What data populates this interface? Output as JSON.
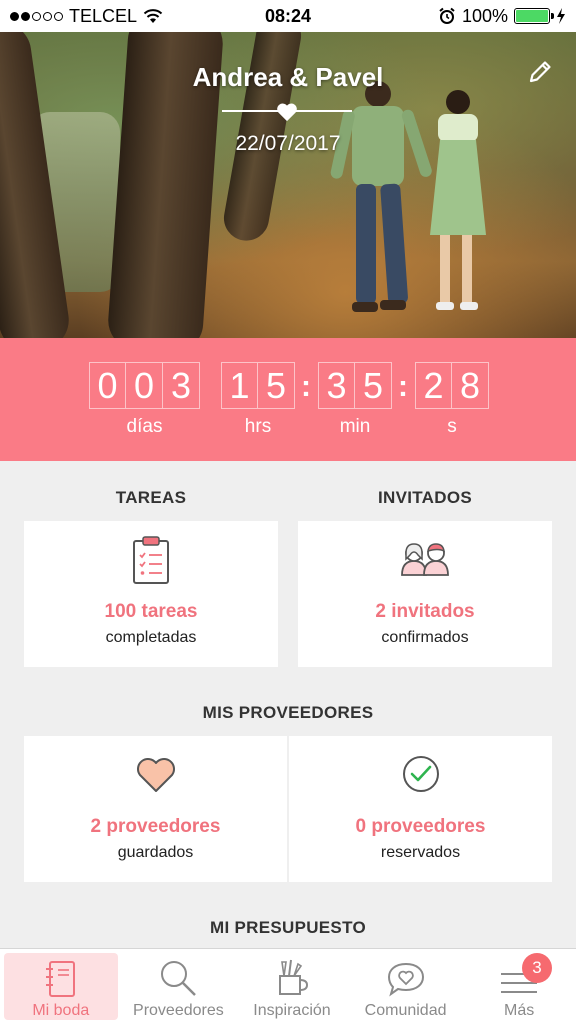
{
  "status_bar": {
    "carrier": "TELCEL",
    "time": "08:24",
    "battery": "100%",
    "battery_level": 1.0
  },
  "hero": {
    "title": "Andrea & Pavel",
    "date": "22/07/2017"
  },
  "countdown": {
    "days": [
      "0",
      "0",
      "3"
    ],
    "hours": [
      "1",
      "5"
    ],
    "minutes": [
      "3",
      "5"
    ],
    "seconds": [
      "2",
      "8"
    ],
    "labels": {
      "days": "días",
      "hours": "hrs",
      "minutes": "min",
      "seconds": "s"
    },
    "background": "#fa7b86"
  },
  "tasks": {
    "title": "TAREAS",
    "value": "100 tareas",
    "sub": "completadas",
    "icon": "clipboard-checklist-icon"
  },
  "guests": {
    "title": "INVITADOS",
    "value": "2 invitados",
    "sub": "confirmados",
    "icon": "guests-couple-icon"
  },
  "vendors": {
    "title": "MIS PROVEEDORES",
    "saved_value": "2 proveedores",
    "saved_sub": "guardados",
    "saved_icon": "heart-icon",
    "booked_value": "0 proveedores",
    "booked_sub": "reservados",
    "booked_icon": "check-circle-icon"
  },
  "budget": {
    "title": "MI PRESUPUESTO"
  },
  "tabbar": {
    "items": [
      {
        "label": "Mi boda",
        "icon": "notebook-icon"
      },
      {
        "label": "Proveedores",
        "icon": "search-icon"
      },
      {
        "label": "Inspiración",
        "icon": "pencil-cup-icon"
      },
      {
        "label": "Comunidad",
        "icon": "heart-bubble-icon"
      },
      {
        "label": "Más",
        "icon": "menu-icon",
        "badge": "3"
      }
    ]
  },
  "colors": {
    "accent": "#f0737e",
    "badge": "#f66a6f"
  }
}
